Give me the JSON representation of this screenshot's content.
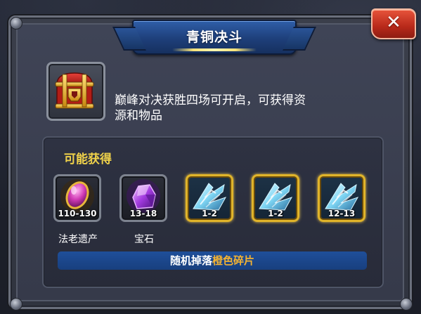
{
  "title": "青铜决斗",
  "close_label": "✕",
  "chest_icon": "treasure-chest-icon",
  "description": "巅峰对决获胜四场可开启，可获得资源和物品",
  "description_line1": "巅峰对决获胜四场可开启，可获得资",
  "description_line2": "源和物品",
  "rewards": {
    "title": "可能获得",
    "items": [
      {
        "icon": "legacy-gem-icon",
        "count": "110-130",
        "label": "法老遗产",
        "frame": "gray"
      },
      {
        "icon": "purple-gem-icon",
        "count": "13-18",
        "label": "宝石",
        "frame": "gray"
      },
      {
        "icon": "ice-weapon-shard-icon",
        "count": "1-2",
        "label": "",
        "frame": "gold"
      },
      {
        "icon": "ice-weapon-shard-icon",
        "count": "1-2",
        "label": "",
        "frame": "gold"
      },
      {
        "icon": "ice-weapon-shard-icon",
        "count": "12-13",
        "label": "",
        "frame": "gold"
      }
    ]
  },
  "drop_note": {
    "prefix": "随机掉落",
    "highlight": "橙色碎片"
  },
  "colors": {
    "title_tab": "#1e3f7a",
    "highlight_text": "#f2b233",
    "section_title": "#f0d24a",
    "close_button": "#b8291a"
  }
}
